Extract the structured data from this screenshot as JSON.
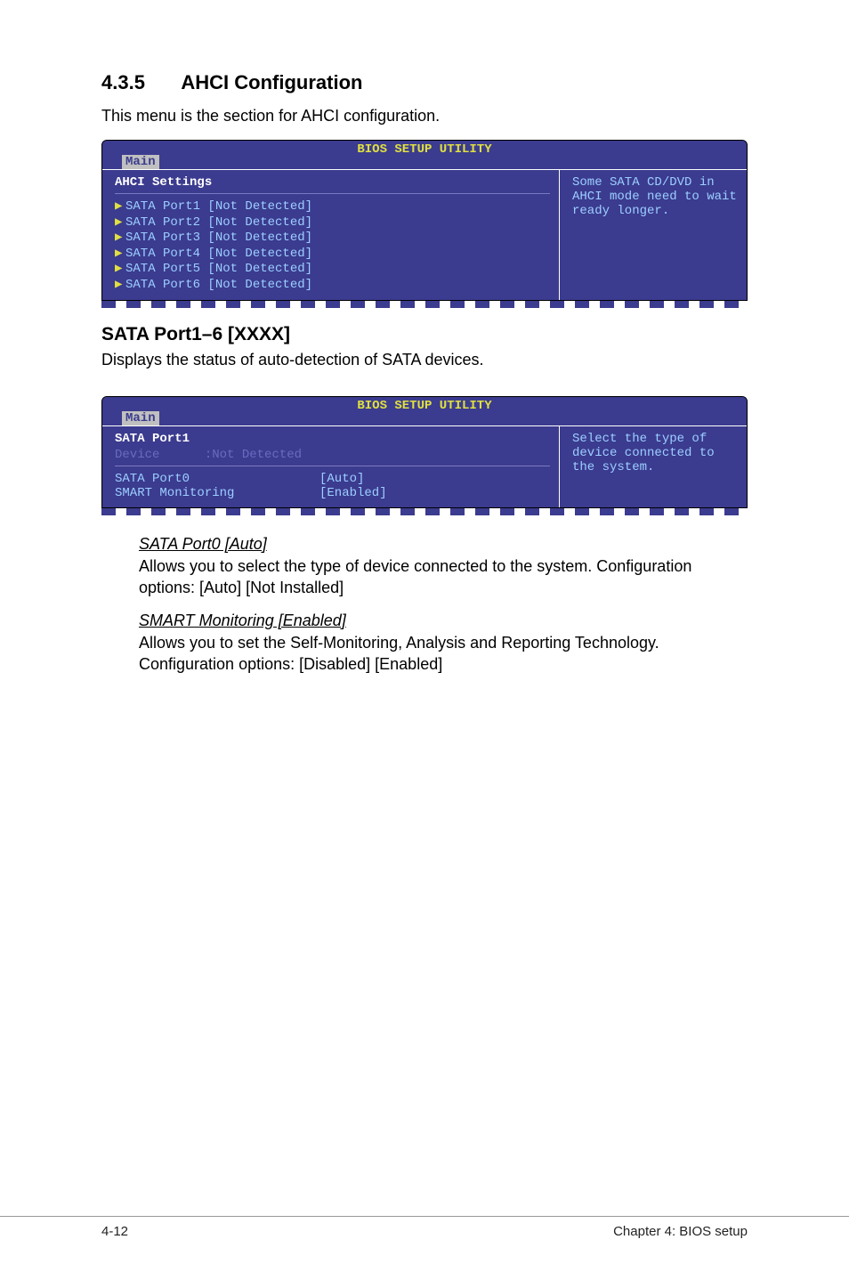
{
  "section": {
    "number": "4.3.5",
    "title": "AHCI Configuration",
    "description": "This menu is the section for AHCI configuration."
  },
  "bios1": {
    "header": "BIOS SETUP UTILITY",
    "tab": "Main",
    "left_title": "AHCI Settings",
    "items": [
      "SATA Port1 [Not Detected]",
      "SATA Port2 [Not Detected]",
      "SATA Port3 [Not Detected]",
      "SATA Port4 [Not Detected]",
      "SATA Port5 [Not Detected]",
      "SATA Port6 [Not Detected]"
    ],
    "help": "Some SATA CD/DVD in AHCI mode need to wait ready longer."
  },
  "subsection": {
    "heading": "SATA Port1–6 [XXXX]",
    "desc": "Displays the status of auto-detection of SATA devices."
  },
  "bios2": {
    "header": "BIOS SETUP UTILITY",
    "tab": "Main",
    "left_title": "SATA Port1",
    "device_label": "Device",
    "device_value": ":Not Detected",
    "rows": [
      {
        "label": "SATA Port0",
        "value": "[Auto]"
      },
      {
        "label": "SMART Monitoring",
        "value": "[Enabled]"
      }
    ],
    "help": "Select the type of device connected to the system."
  },
  "options": [
    {
      "title": "SATA Port0 [Auto]",
      "desc": "Allows you to select the type of device connected to the system. Configuration options: [Auto] [Not Installed]"
    },
    {
      "title": "SMART Monitoring [Enabled]",
      "desc": "Allows you to set the Self-Monitoring, Analysis and Reporting Technology. Configuration options: [Disabled] [Enabled]"
    }
  ],
  "footer": {
    "left": "4-12",
    "right": "Chapter 4: BIOS setup"
  }
}
